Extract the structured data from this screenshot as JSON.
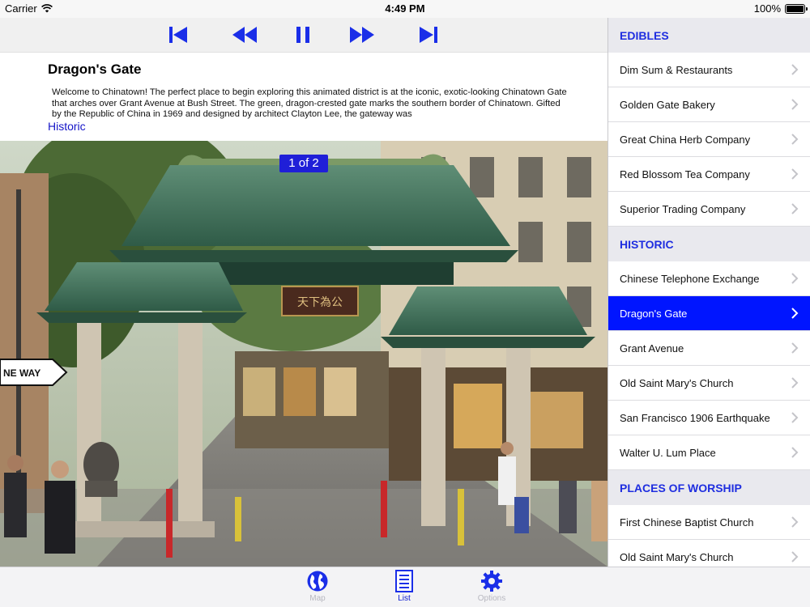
{
  "status": {
    "carrier": "Carrier",
    "time": "4:49 PM",
    "battery": "100%"
  },
  "detail": {
    "title": "Dragon's Gate",
    "description": "Welcome to Chinatown! The perfect place to begin exploring this animated district is at the iconic, exotic-looking Chinatown Gate that arches over Grant Avenue at Bush Street. The green, dragon-crested gate marks the southern border of Chinatown. Gifted by the Republic of China in 1969 and designed by architect Clayton Lee, the gateway was",
    "category": "Historic",
    "photo_counter": "1 of 2",
    "photo_signs": {
      "gate_sign": "天下為公",
      "street_sign": "NE WAY"
    }
  },
  "toolbar": {
    "buttons": [
      "skip-back-icon",
      "rewind-icon",
      "pause-icon",
      "fast-forward-icon",
      "skip-forward-icon"
    ]
  },
  "list": {
    "sections": [
      {
        "header": "EDIBLES",
        "items": [
          "Dim Sum & Restaurants",
          "Golden Gate Bakery",
          "Great China Herb Company",
          "Red Blossom Tea Company",
          "Superior Trading Company"
        ]
      },
      {
        "header": "HISTORIC",
        "items": [
          "Chinese Telephone Exchange",
          "Dragon's Gate",
          "Grant Avenue",
          "Old Saint Mary's Church",
          "San Francisco 1906 Earthquake",
          "Walter U. Lum Place"
        ]
      },
      {
        "header": "PLACES OF WORSHIP",
        "items": [
          "First Chinese Baptist Church",
          "Old Saint Mary's Church"
        ]
      }
    ],
    "selected": "Dragon's Gate"
  },
  "tabs": [
    {
      "label": "Map",
      "icon": "globe-icon"
    },
    {
      "label": "List",
      "icon": "list-icon"
    },
    {
      "label": "Options",
      "icon": "gear-icon"
    }
  ],
  "colors": {
    "accent": "#0a1ad0",
    "selected_row": "#0015ff",
    "section_header_text": "#1f2ee0",
    "counter_badge": "#1f1fd8"
  }
}
